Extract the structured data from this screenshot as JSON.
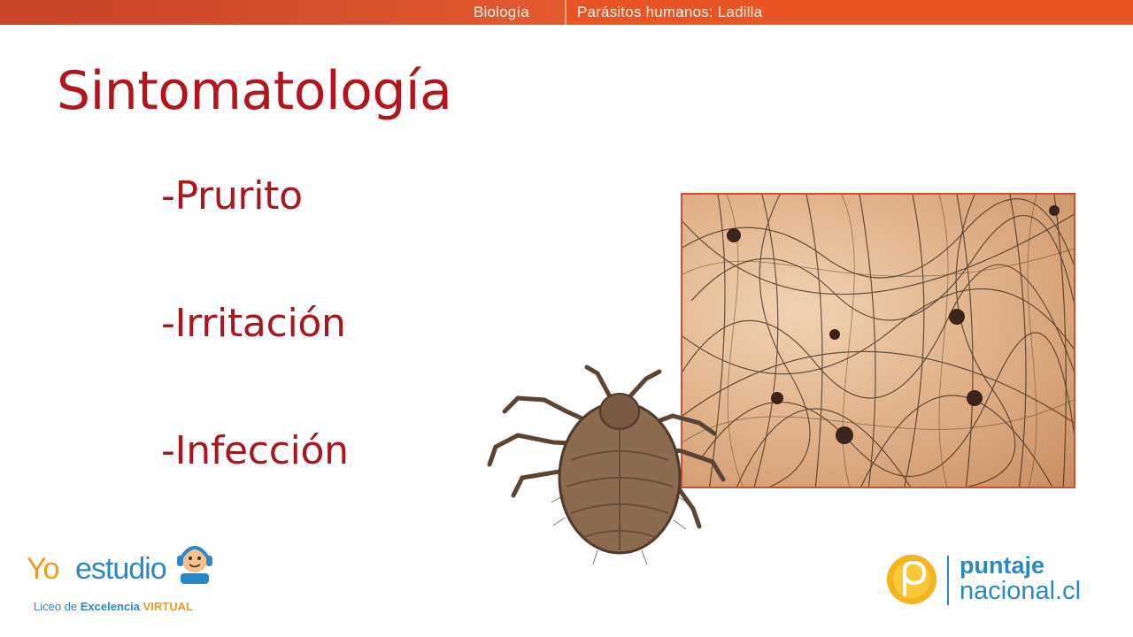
{
  "header": {
    "subject": "Biología",
    "topic": "Parásitos humanos: Ladilla"
  },
  "slide": {
    "title": "Sintomatología",
    "symptoms": [
      "-Prurito",
      "-Irritación",
      "-Infección"
    ]
  },
  "images": {
    "hair_photo": "pubic-hair-with-lice-photo",
    "louse": "crab-louse-illustration"
  },
  "logos": {
    "left": {
      "yo": "Yo",
      "estudio": "estudio",
      "tagline_prefix": "Liceo de ",
      "tagline_bold": "Excelencia",
      "tagline_virtual": "VIRTUAL"
    },
    "right": {
      "line1": "puntaje",
      "line2": "nacional.cl"
    }
  },
  "colors": {
    "header_left": "#c8442a",
    "header_right": "#e85424",
    "title": "#b3151d",
    "brand_blue": "#2a88c6",
    "brand_orange": "#f29a1c"
  }
}
